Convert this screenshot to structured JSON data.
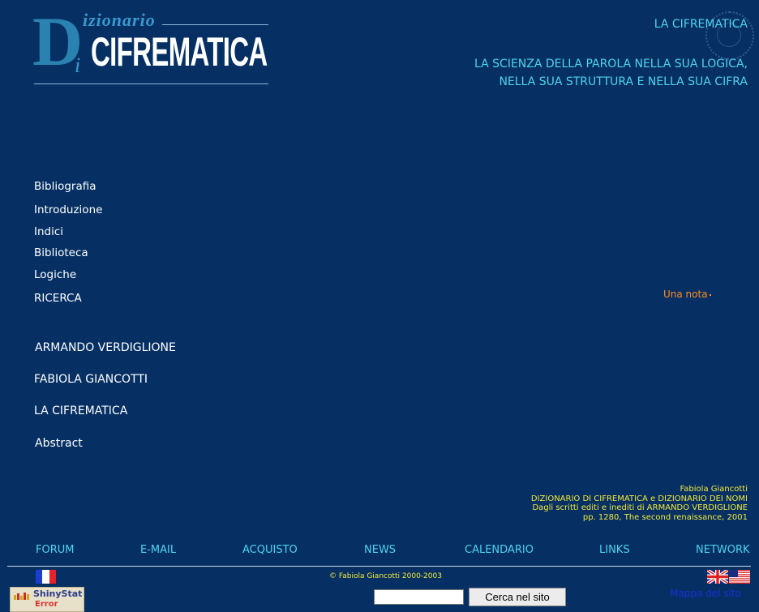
{
  "logo": {
    "d": "D",
    "izionario": "izionario",
    "i": "i",
    "cifrematica": "CIFREMATICA"
  },
  "header": {
    "title": "LA CIFREMATICA",
    "tagline_1": "LA SCIENZA DELLA PAROLA NELLA SUA LOGICA,",
    "tagline_2": "NELLA SUA STRUTTURA E NELLA SUA CIFRA"
  },
  "nav": [
    {
      "label": "Bibliografia"
    },
    {
      "label": "Introduzione"
    },
    {
      "label": "Indici"
    },
    {
      "label": "Biblioteca"
    },
    {
      "label": "Logiche"
    },
    {
      "label": "RICERCA"
    }
  ],
  "nav2": [
    {
      "label": "ARMANDO VERDIGLIONE"
    },
    {
      "label": "FABIOLA GIANCOTTI"
    },
    {
      "label": "LA CIFREMATICA"
    },
    {
      "label": "Abstract"
    }
  ],
  "note": {
    "label": "Una nota"
  },
  "book": {
    "line1": "Fabiola Giancotti",
    "line2": "DIZIONARIO DI CIFREMATICA e DIZIONARIO DEI NOMI",
    "line3": "Dagli scritti editi e inediti di ARMANDO VERDIGLIONE",
    "line4": "pp. 1280, The second renaissance, 2001"
  },
  "footer_nav": [
    {
      "label": "FORUM"
    },
    {
      "label": "E-MAIL"
    },
    {
      "label": "ACQUISTO"
    },
    {
      "label": "NEWS"
    },
    {
      "label": "CALENDARIO"
    },
    {
      "label": "LINKS"
    },
    {
      "label": "NETWORK"
    }
  ],
  "copyright": "© Fabiola Giancotti 2000-2003",
  "shinystat": {
    "brand": "ShinyStat",
    "status": "Error"
  },
  "search": {
    "button_label": "Cerca nel sito",
    "value": ""
  },
  "sitemap_label": "Mappa del sito",
  "icons": [
    "france-flag-icon",
    "uk-flag-icon",
    "us-flag-icon",
    "seal-icon",
    "shinystat-icon"
  ],
  "colors": {
    "background": "#063063",
    "cyan": "#4fd3f0",
    "yellow": "#f3e83c",
    "orange": "#ff8a1f",
    "link_blue": "#1530d8"
  }
}
